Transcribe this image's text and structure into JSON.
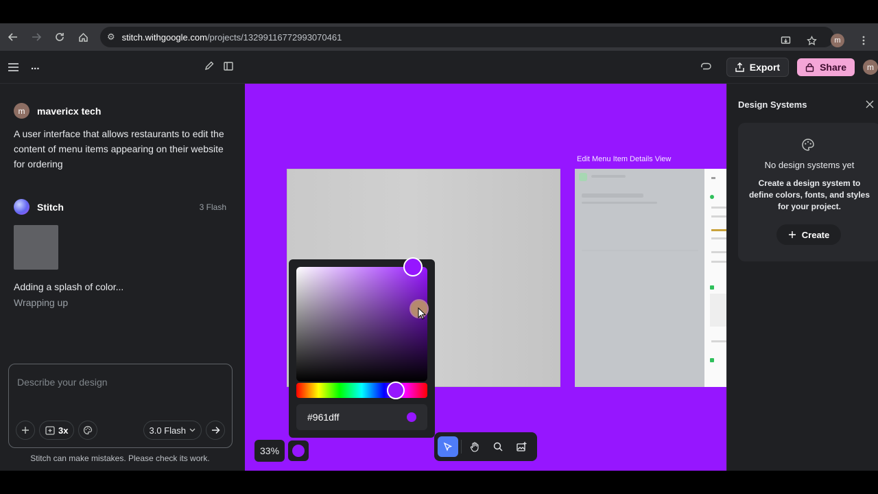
{
  "browser": {
    "url_domain": "stitch.withgoogle.com",
    "url_path": "/projects/13299116772993070461",
    "profile_initial": "m"
  },
  "appbar": {
    "more_label": "...",
    "export_label": "Export",
    "share_label": "Share",
    "avatar_initial": "m"
  },
  "chat": {
    "user_name": "mavericx tech",
    "user_initial": "m",
    "user_message": "A user interface that allows restaurants to edit the content of menu items appearing on their website for ordering",
    "assistant_name": "Stitch",
    "assistant_badge": "3 Flash",
    "status_line_1": "Adding a splash of color...",
    "status_line_2": "Wrapping up"
  },
  "prompt": {
    "placeholder": "Describe your design",
    "variants_label": "3x",
    "model_label": "3.0 Flash",
    "disclaimer": "Stitch can make mistakes. Please check its work."
  },
  "canvas": {
    "background_color": "#9616ff",
    "frame_b_label": "Edit Menu Item Details View",
    "zoom_label": "33%"
  },
  "color_picker": {
    "hex_value": "#961dff",
    "hue_fraction": 0.76,
    "saturation_fraction": 0.89,
    "brightness_fraction": 1.0
  },
  "design_systems": {
    "title": "Design Systems",
    "empty_heading": "No design systems yet",
    "empty_description": "Create a design system to define colors, fonts, and styles for your project.",
    "create_label": "Create"
  }
}
